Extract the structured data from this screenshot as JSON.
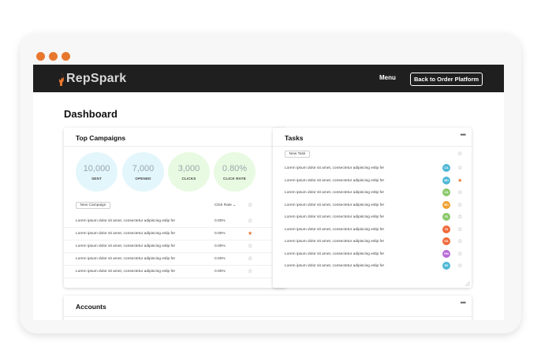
{
  "window": {
    "dots_color": "#e8772e"
  },
  "navbar": {
    "logo_text": "RepSpark",
    "menu_label": "Menu",
    "back_button_label": "Back to Order Platform"
  },
  "page": {
    "title": "Dashboard"
  },
  "campaigns": {
    "title": "Top Campaigns",
    "more": "•••",
    "stats": [
      {
        "value": "10,000",
        "label": "SENT",
        "color": "#e3f6fb"
      },
      {
        "value": "7,000",
        "label": "OPENED",
        "color": "#e3f6fb"
      },
      {
        "value": "3,000",
        "label": "CLICKS",
        "color": "#e9fae2"
      },
      {
        "value": "0.80%",
        "label": "CLICK RATE",
        "color": "#e9fae2"
      }
    ],
    "new_button": "New Campaign",
    "sort_label": "Click Rate",
    "rows": [
      {
        "text": "Lorem ipsum dolor sit amet, consectetur adipiscing eslip fer",
        "rate": "0.00%",
        "starred": false
      },
      {
        "text": "Lorem ipsum dolor sit amet, consectetur adipiscing eslip fer",
        "rate": "0.00%",
        "starred": true
      },
      {
        "text": "Lorem ipsum dolor sit amet, consectetur adipiscing eslip fer",
        "rate": "0.00%",
        "starred": false
      },
      {
        "text": "Lorem ipsum dolor sit amet, consectetur adipiscing eslip fer",
        "rate": "0.00%",
        "starred": false
      },
      {
        "text": "Lorem ipsum dolor sit amet, consectetur adipiscing eslip fer",
        "rate": "0.00%",
        "starred": false
      }
    ]
  },
  "tasks": {
    "title": "Tasks",
    "more": "•••",
    "new_button": "New Task",
    "rows": [
      {
        "text": "Lorem ipsum dolor sit amet, consectetur adipiscing eslip fer",
        "avatar": "CA",
        "avatar_color": "#4fb8d6",
        "starred": false
      },
      {
        "text": "Lorem ipsum dolor sit amet, consectetur adipiscing eslip fer",
        "avatar": "MD",
        "avatar_color": "#4fb8d6",
        "starred": true
      },
      {
        "text": "Lorem ipsum dolor sit amet, consectetur adipiscing eslip fer",
        "avatar": "CA",
        "avatar_color": "#8bc86a",
        "starred": false
      },
      {
        "text": "Lorem ipsum dolor sit amet, consectetur adipiscing eslip fer",
        "avatar": "MD",
        "avatar_color": "#f0a030",
        "starred": false
      },
      {
        "text": "Lorem ipsum dolor sit amet, consectetur adipiscing eslip fer",
        "avatar": "RI",
        "avatar_color": "#8bc86a",
        "starred": false
      },
      {
        "text": "Lorem ipsum dolor sit amet, consectetur adipiscing eslip fer",
        "avatar": "TA",
        "avatar_color": "#ef6b3a",
        "starred": false
      },
      {
        "text": "Lorem ipsum dolor sit amet, consectetur adipiscing eslip fer",
        "avatar": "DA",
        "avatar_color": "#ef6b3a",
        "starred": false
      },
      {
        "text": "Lorem ipsum dolor sit amet, consectetur adipiscing eslip fer",
        "avatar": "RM",
        "avatar_color": "#b76bd6",
        "starred": false
      },
      {
        "text": "Lorem ipsum dolor sit amet, consectetur adipiscing eslip fer",
        "avatar": "ES",
        "avatar_color": "#4fb8d6",
        "starred": false
      }
    ]
  },
  "accounts": {
    "title": "Accounts",
    "more": "•••"
  }
}
